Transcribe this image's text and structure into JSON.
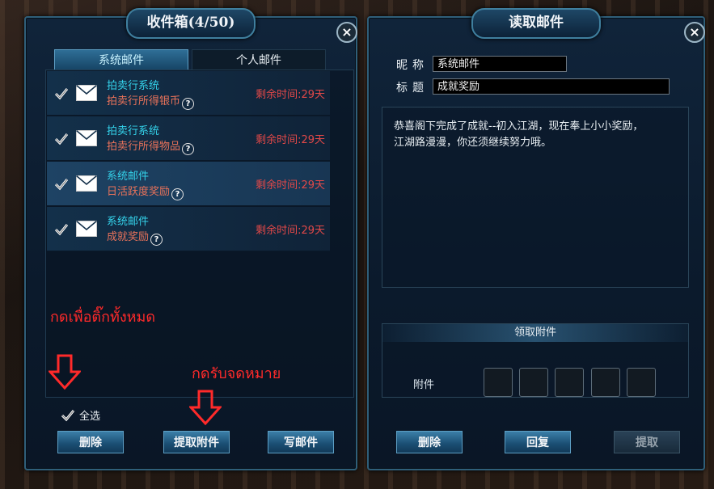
{
  "inbox": {
    "title": "收件箱(4/50)",
    "tabs": [
      {
        "label": "系统邮件"
      },
      {
        "label": "个人邮件"
      }
    ],
    "mails": [
      {
        "sender": "拍卖行系统",
        "subject": "拍卖行所得银币",
        "remaining": "剩余时间:29天"
      },
      {
        "sender": "拍卖行系统",
        "subject": "拍卖行所得物品",
        "remaining": "剩余时间:29天"
      },
      {
        "sender": "系统邮件",
        "subject": "日活跃度奖励",
        "remaining": "剩余时间:29天"
      },
      {
        "sender": "系统邮件",
        "subject": "成就奖励",
        "remaining": "剩余时间:29天"
      }
    ],
    "select_all_label": "全选",
    "buttons": {
      "delete": "删除",
      "take_attachments": "提取附件",
      "write_mail": "写邮件"
    },
    "annotations": {
      "select_all_hint": "กดเพื่อติ๊กทั้งหมด",
      "take_hint": "กดรับจดหมาย"
    },
    "annotation_color": "#ff2a2a"
  },
  "reader": {
    "title": "读取邮件",
    "nickname_label": "昵称",
    "nickname_value": "系统邮件",
    "subject_label": "标题",
    "subject_value": "成就奖励",
    "body_line1": "恭喜阁下完成了成就--初入江湖，现在奉上小小奖励，",
    "body_line2": "江湖路漫漫，你还须继续努力哦。",
    "attachment_header": "领取附件",
    "attachment_label": "附件",
    "buttons": {
      "delete": "删除",
      "reply": "回复",
      "take": "提取"
    }
  }
}
